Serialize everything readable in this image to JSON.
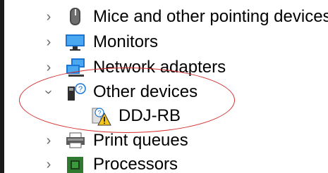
{
  "tree": {
    "items": [
      {
        "label": "Mice and other pointing devices",
        "icon": "mouse-icon",
        "expanded": false
      },
      {
        "label": "Monitors",
        "icon": "monitor-icon",
        "expanded": false
      },
      {
        "label": "Network adapters",
        "icon": "network-adapter-icon",
        "expanded": false
      },
      {
        "label": "Other devices",
        "icon": "unknown-device-icon",
        "expanded": true,
        "children": [
          {
            "label": "DDJ-RB",
            "icon": "device-warning-icon"
          }
        ]
      },
      {
        "label": "Print queues",
        "icon": "printer-icon",
        "expanded": false
      },
      {
        "label": "Processors",
        "icon": "processor-icon",
        "expanded": false
      }
    ]
  },
  "colors": {
    "annotation": "#d52e2e",
    "chevron": "#6b6b6b",
    "text": "#000000"
  }
}
